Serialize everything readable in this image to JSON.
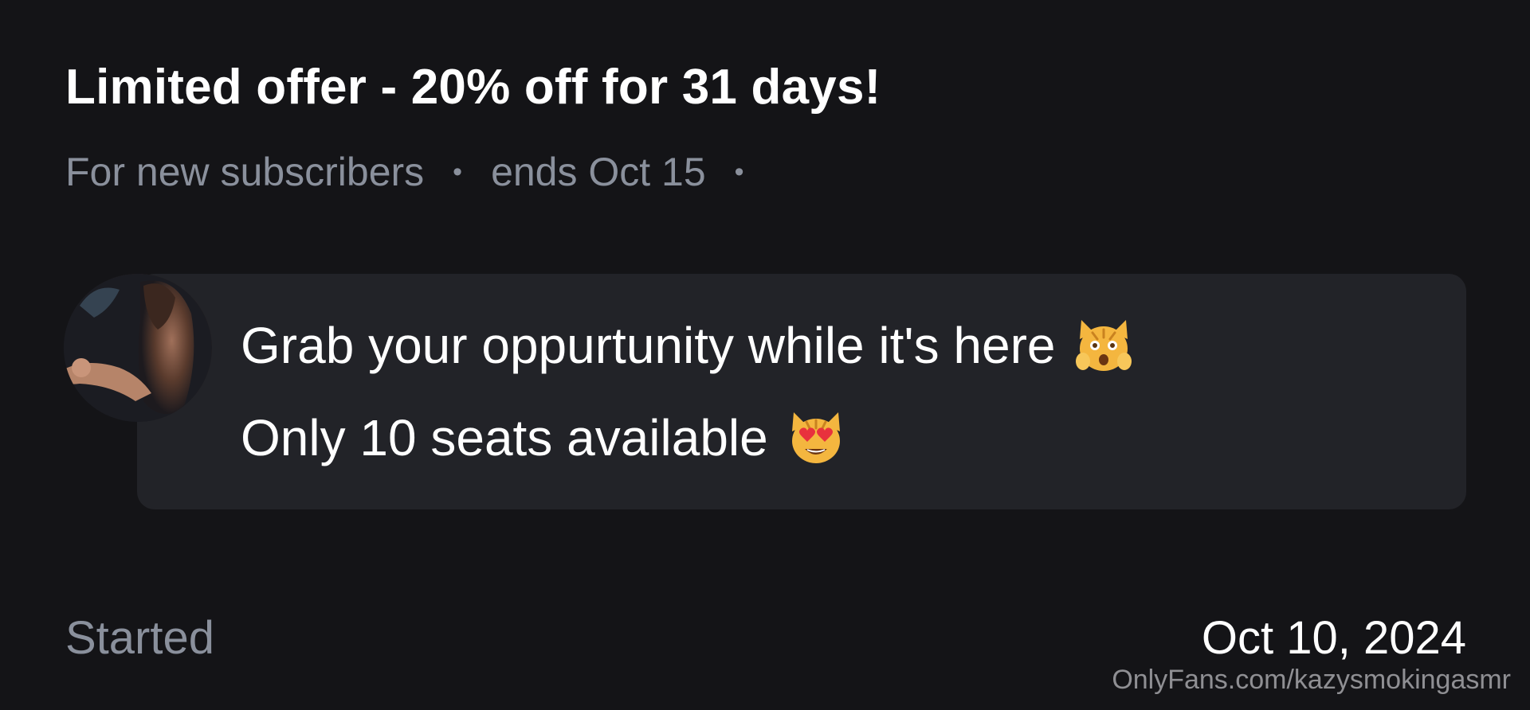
{
  "offer": {
    "title": "Limited offer - 20% off for 31 days!",
    "audience": "For new subscribers",
    "separator": "•",
    "ends": "ends Oct 15"
  },
  "message": {
    "avatar_icon": "creator-avatar",
    "line1": "Grab your oppurtunity while it's here",
    "line1_emoji": "weary-cat-face-icon",
    "line2": "Only 10 seats available",
    "line2_emoji": "heart-eyes-cat-icon"
  },
  "footer": {
    "started_label": "Started",
    "started_date": "Oct 10, 2024"
  },
  "watermark": "OnlyFans.com/kazysmokingasmr",
  "colors": {
    "background": "#141417",
    "bubble": "#222328",
    "muted_text": "#8a909c",
    "primary_text": "#ffffff",
    "emoji_yellow": "#f4b63f"
  }
}
